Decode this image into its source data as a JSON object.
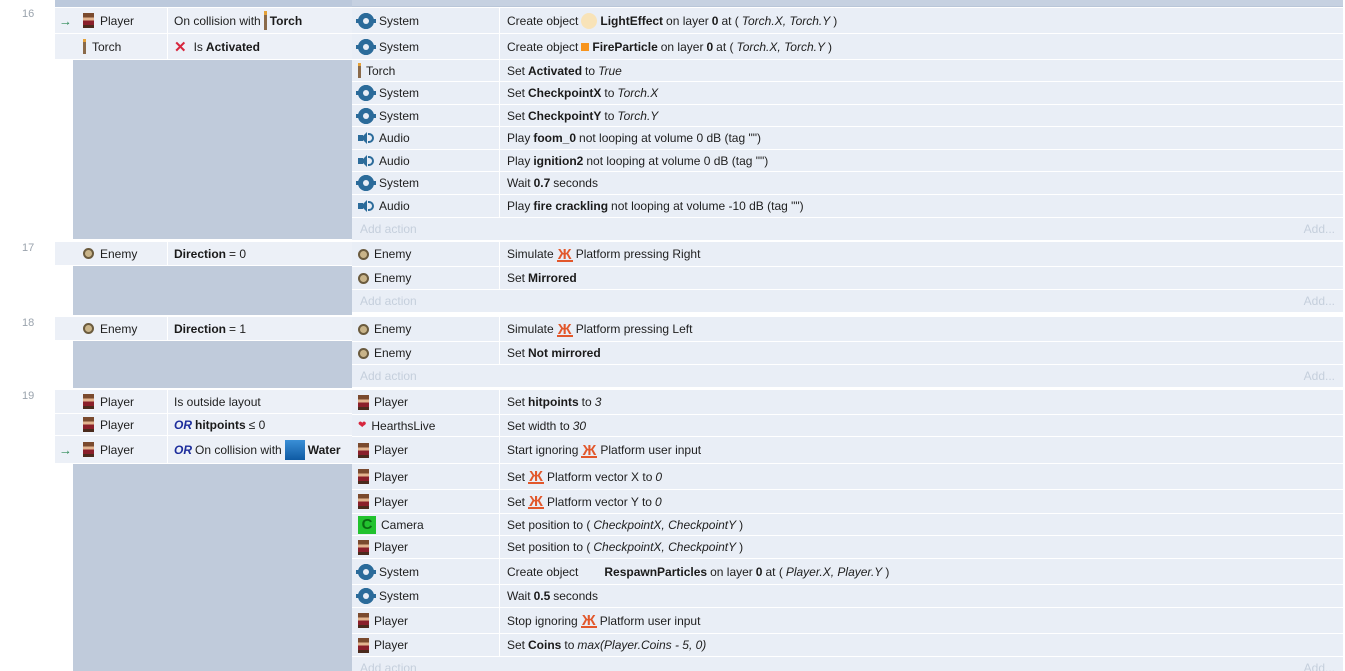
{
  "labels": {
    "add_action": "Add action",
    "add": "Add..."
  },
  "events": [
    {
      "number": "16",
      "conditions": [
        {
          "arrow": "→",
          "object": "Player",
          "icon": "player-icon",
          "parts": [
            [
              "t",
              "On collision with"
            ],
            [
              "icon",
              "torch-icon"
            ],
            [
              "b",
              "Torch"
            ]
          ]
        },
        {
          "arrow": "",
          "object": "Torch",
          "icon": "torch-icon",
          "parts": [
            [
              "icon",
              "cross-icon"
            ],
            [
              "t",
              "Is"
            ],
            [
              "b",
              "Activated"
            ]
          ]
        }
      ],
      "actions": [
        {
          "object": "System",
          "icon": "gear-icon",
          "parts": [
            [
              "t",
              "Create object"
            ],
            [
              "icon",
              "light-icon"
            ],
            [
              "b",
              "LightEffect"
            ],
            [
              "t",
              "on layer"
            ],
            [
              "b",
              "0"
            ],
            [
              "t",
              "at ("
            ],
            [
              "i",
              "Torch.X, Torch.Y"
            ],
            [
              "t",
              ")"
            ]
          ]
        },
        {
          "object": "System",
          "icon": "gear-icon",
          "parts": [
            [
              "t",
              "Create object"
            ],
            [
              "icon",
              "fire-icon"
            ],
            [
              "b",
              "FireParticle"
            ],
            [
              "t",
              "on layer"
            ],
            [
              "b",
              "0"
            ],
            [
              "t",
              "at ("
            ],
            [
              "i",
              "Torch.X, Torch.Y"
            ],
            [
              "t",
              ")"
            ]
          ]
        },
        {
          "object": "Torch",
          "icon": "torch-icon",
          "parts": [
            [
              "t",
              "Set"
            ],
            [
              "b",
              "Activated"
            ],
            [
              "t",
              "to"
            ],
            [
              "i",
              "True"
            ]
          ]
        },
        {
          "object": "System",
          "icon": "gear-icon",
          "parts": [
            [
              "t",
              "Set"
            ],
            [
              "b",
              "CheckpointX"
            ],
            [
              "t",
              "to"
            ],
            [
              "i",
              "Torch.X"
            ]
          ]
        },
        {
          "object": "System",
          "icon": "gear-icon",
          "parts": [
            [
              "t",
              "Set"
            ],
            [
              "b",
              "CheckpointY"
            ],
            [
              "t",
              "to"
            ],
            [
              "i",
              "Torch.Y"
            ]
          ]
        },
        {
          "object": "Audio",
          "icon": "audio-icon",
          "parts": [
            [
              "t",
              "Play"
            ],
            [
              "b",
              "foom_0"
            ],
            [
              "t",
              "not looping at volume 0 dB (tag \"\")"
            ]
          ]
        },
        {
          "object": "Audio",
          "icon": "audio-icon",
          "parts": [
            [
              "t",
              "Play"
            ],
            [
              "b",
              "ignition2"
            ],
            [
              "t",
              "not looping at volume 0 dB (tag \"\")"
            ]
          ]
        },
        {
          "object": "System",
          "icon": "gear-icon",
          "parts": [
            [
              "t",
              "Wait"
            ],
            [
              "b",
              "0.7"
            ],
            [
              "t",
              "seconds"
            ]
          ]
        },
        {
          "object": "Audio",
          "icon": "audio-icon",
          "parts": [
            [
              "t",
              "Play"
            ],
            [
              "b",
              "fire crackling"
            ],
            [
              "t",
              "not looping at volume -10 dB (tag \"\")"
            ]
          ]
        }
      ]
    },
    {
      "number": "17",
      "conditions": [
        {
          "arrow": "",
          "object": "Enemy",
          "icon": "enemy-icon",
          "parts": [
            [
              "b",
              "Direction"
            ],
            [
              "t",
              "= 0"
            ]
          ]
        }
      ],
      "actions": [
        {
          "object": "Enemy",
          "icon": "enemy-icon",
          "parts": [
            [
              "t",
              "Simulate"
            ],
            [
              "icon",
              "platform-icon"
            ],
            [
              "t",
              "Platform pressing Right"
            ]
          ]
        },
        {
          "object": "Enemy",
          "icon": "enemy-icon",
          "parts": [
            [
              "t",
              "Set"
            ],
            [
              "b",
              "Mirrored"
            ]
          ]
        }
      ]
    },
    {
      "number": "18",
      "conditions": [
        {
          "arrow": "",
          "object": "Enemy",
          "icon": "enemy-icon",
          "parts": [
            [
              "b",
              "Direction"
            ],
            [
              "t",
              "= 1"
            ]
          ]
        }
      ],
      "actions": [
        {
          "object": "Enemy",
          "icon": "enemy-icon",
          "parts": [
            [
              "t",
              "Simulate"
            ],
            [
              "icon",
              "platform-icon"
            ],
            [
              "t",
              "Platform pressing Left"
            ]
          ]
        },
        {
          "object": "Enemy",
          "icon": "enemy-icon",
          "parts": [
            [
              "t",
              "Set"
            ],
            [
              "b",
              "Not mirrored"
            ]
          ]
        }
      ]
    },
    {
      "number": "19",
      "conditions": [
        {
          "arrow": "",
          "object": "Player",
          "icon": "player-icon",
          "parts": [
            [
              "t",
              "Is outside layout"
            ]
          ]
        },
        {
          "arrow": "",
          "object": "Player",
          "icon": "player-icon",
          "parts": [
            [
              "or",
              "OR"
            ],
            [
              "b",
              "hitpoints"
            ],
            [
              "t",
              "≤ 0"
            ]
          ]
        },
        {
          "arrow": "→",
          "object": "Player",
          "icon": "player-icon",
          "parts": [
            [
              "or",
              "OR"
            ],
            [
              "t",
              "On collision with"
            ],
            [
              "icon",
              "water-icon"
            ],
            [
              "b",
              "Water"
            ]
          ]
        }
      ],
      "actions": [
        {
          "object": "Player",
          "icon": "player-icon",
          "parts": [
            [
              "t",
              "Set"
            ],
            [
              "b",
              "hitpoints"
            ],
            [
              "t",
              "to"
            ],
            [
              "i",
              "3"
            ]
          ]
        },
        {
          "object": "HearthsLive",
          "icon": "heart-icon",
          "parts": [
            [
              "t",
              "Set width to"
            ],
            [
              "i",
              "30"
            ]
          ]
        },
        {
          "object": "Player",
          "icon": "player-icon",
          "parts": [
            [
              "t",
              "Start ignoring"
            ],
            [
              "icon",
              "platform-icon"
            ],
            [
              "t",
              "Platform user input"
            ]
          ]
        },
        {
          "object": "Player",
          "icon": "player-icon",
          "parts": [
            [
              "t",
              "Set"
            ],
            [
              "icon",
              "platform-icon"
            ],
            [
              "t",
              "Platform vector X to"
            ],
            [
              "i",
              "0"
            ]
          ]
        },
        {
          "object": "Player",
          "icon": "player-icon",
          "parts": [
            [
              "t",
              "Set"
            ],
            [
              "icon",
              "platform-icon"
            ],
            [
              "t",
              "Platform vector Y to"
            ],
            [
              "i",
              "0"
            ]
          ]
        },
        {
          "object": "Camera",
          "icon": "camera-icon",
          "parts": [
            [
              "t",
              "Set position to ("
            ],
            [
              "i",
              "CheckpointX, CheckpointY"
            ],
            [
              "t",
              ")"
            ]
          ]
        },
        {
          "object": "Player",
          "icon": "player-icon",
          "parts": [
            [
              "t",
              "Set position to ("
            ],
            [
              "i",
              "CheckpointX, CheckpointY"
            ],
            [
              "t",
              ")"
            ]
          ]
        },
        {
          "object": "System",
          "icon": "gear-icon",
          "parts": [
            [
              "t",
              "Create object"
            ],
            [
              "icon",
              "blank-icon"
            ],
            [
              "b",
              "RespawnParticles"
            ],
            [
              "t",
              "on layer"
            ],
            [
              "b",
              "0"
            ],
            [
              "t",
              "at ("
            ],
            [
              "i",
              "Player.X, Player.Y"
            ],
            [
              "t",
              ")"
            ]
          ]
        },
        {
          "object": "System",
          "icon": "gear-icon",
          "parts": [
            [
              "t",
              "Wait"
            ],
            [
              "b",
              "0.5"
            ],
            [
              "t",
              "seconds"
            ]
          ]
        },
        {
          "object": "Player",
          "icon": "player-icon",
          "parts": [
            [
              "t",
              "Stop ignoring"
            ],
            [
              "icon",
              "platform-icon"
            ],
            [
              "t",
              "Platform user input"
            ]
          ]
        },
        {
          "object": "Player",
          "icon": "player-icon",
          "parts": [
            [
              "t",
              "Set"
            ],
            [
              "b",
              "Coins"
            ],
            [
              "t",
              "to"
            ],
            [
              "i",
              "max(Player.Coins - 5, 0)"
            ]
          ]
        }
      ]
    }
  ]
}
